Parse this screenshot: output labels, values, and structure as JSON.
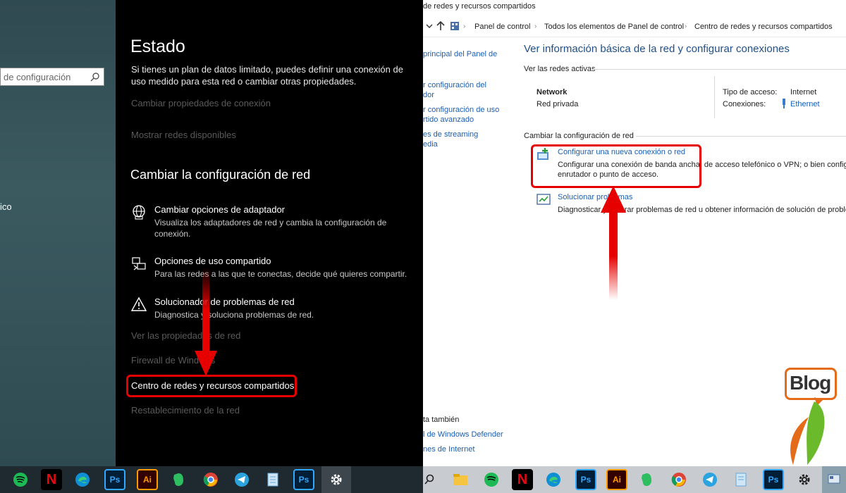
{
  "left_pane": {
    "search_placeholder": "de configuración",
    "fragment": "ico"
  },
  "settings": {
    "title": "Estado",
    "description": "Si tienes un plan de datos limitado, puedes definir una conexión de uso medido para esta red o cambiar otras propiedades.",
    "link_change_properties": "Cambiar propiedades de conexión",
    "link_show_networks": "Mostrar redes disponibles",
    "section_title": "Cambiar la configuración de red",
    "options": [
      {
        "title": "Cambiar opciones de adaptador",
        "desc": "Visualiza los adaptadores de red y cambia la configuración de conexión.",
        "icon": "globe-icon"
      },
      {
        "title": "Opciones de uso compartido",
        "desc": "Para las redes a las que te conectas, decide qué quieres compartir.",
        "icon": "sharing-icon"
      },
      {
        "title": "Solucionador de problemas de red",
        "desc": "Diagnostica y soluciona problemas de red.",
        "icon": "warning-icon"
      }
    ],
    "link_hw_props": "Ver las propiedades de red",
    "link_firewall": "Firewall de Windows",
    "link_centro": "Centro de redes y recursos compartidos",
    "link_reset": "Restablecimiento de la red"
  },
  "control_panel": {
    "window_title": "de redes y recursos compartidos",
    "breadcrumbs": [
      "Panel de control",
      "Todos los elementos de Panel de control",
      "Centro de redes y recursos compartidos"
    ],
    "sidebar": [
      "principal del Panel de",
      "r configuración del",
      "dor",
      "r configuración de uso",
      "rtido avanzado",
      "es de streaming",
      "edia"
    ],
    "sidebar_bottom": [
      "ta también",
      "l de Windows Defender",
      "nes de Internet"
    ],
    "heading": "Ver información básica de la red y configurar conexiones",
    "active_networks_label": "Ver las redes activas",
    "network_name": "Network",
    "network_type": "Red privada",
    "access_type_label": "Tipo de acceso:",
    "access_type_value": "Internet",
    "connections_label": "Conexiones:",
    "connections_value": "Ethernet",
    "change_config_label": "Cambiar la configuración de red",
    "new_connection_link": "Configurar una nueva conexión o red",
    "new_connection_desc_1": "Configurar una conexión de banda ancha, de acceso telefónico o VPN; o bien configu",
    "new_connection_desc_2": "enrutador o punto de acceso.",
    "troubleshoot_link": "Solucionar problemas",
    "troubleshoot_desc": "Diagnosticar y reparar problemas de red u obtener información de solución de proble"
  },
  "logo": {
    "text": "Blog"
  },
  "colors": {
    "highlight": "#e60000",
    "link": "#1a5fb4"
  },
  "taskbar": {
    "left": [
      "spotify-icon",
      "netflix-icon",
      "edge-icon",
      "photoshop-icon",
      "illustrator-icon",
      "evernote-icon",
      "chrome-icon",
      "telegram-icon",
      "notepad-icon",
      "photoshop-icon",
      "settings-icon"
    ],
    "ps_label": "Ps",
    "ai_label": "Ai",
    "netflix_label": "N"
  }
}
